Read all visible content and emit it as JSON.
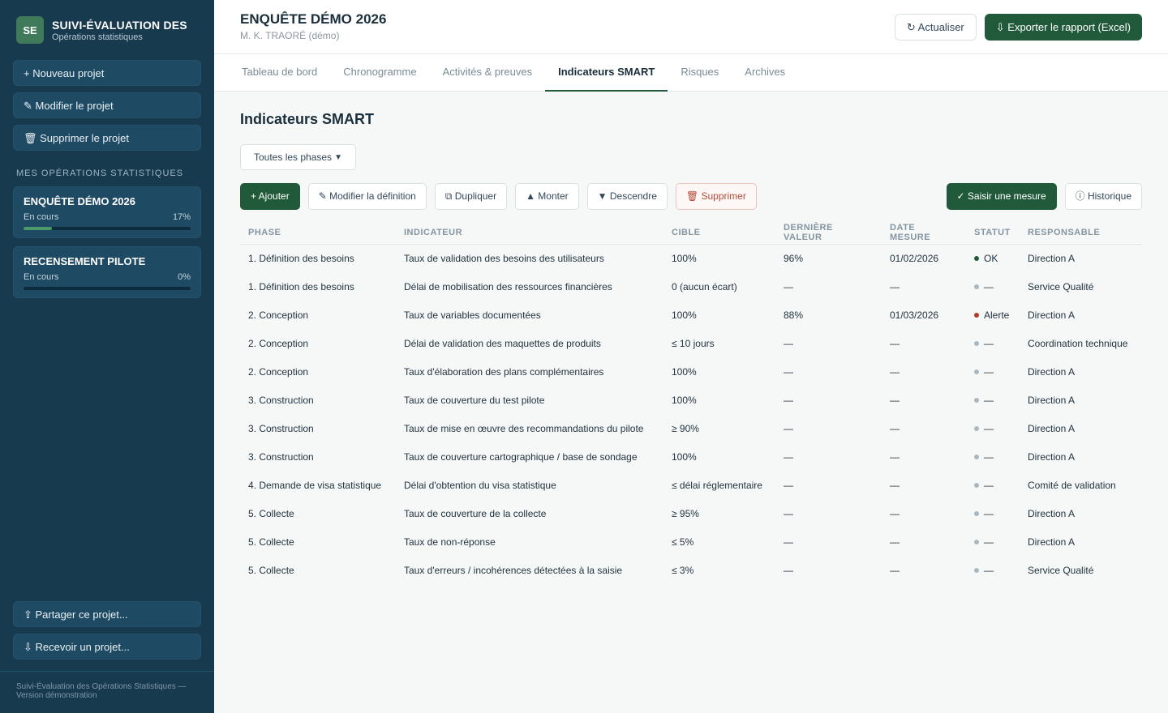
{
  "brand": {
    "logo": "SE",
    "title": "SUIVI-ÉVALUATION DES",
    "subtitle": "Opérations statistiques"
  },
  "sidebar": {
    "actions": [
      {
        "label": "+ Nouveau projet"
      },
      {
        "label": "✎ Modifier le projet"
      },
      {
        "label": "🗑 Supprimer le projet"
      }
    ],
    "section_label": "MES OPÉRATIONS STATISTIQUES",
    "projects": [
      {
        "name": "ENQUÊTE DÉMO 2026",
        "status": "En cours",
        "progress_label": "17%",
        "progress": 0.17
      },
      {
        "name": "RECENSEMENT PILOTE",
        "status": "En cours",
        "progress_label": "0%",
        "progress": 0
      }
    ],
    "bottom": [
      {
        "label": "⇪ Partager ce projet..."
      },
      {
        "label": "⇩ Recevoir un projet..."
      }
    ],
    "footer": "Suivi-Évaluation des Opérations Statistiques — Version démonstration"
  },
  "header": {
    "title": "ENQUÊTE DÉMO 2026",
    "subtitle": "M. K. TRAORÉ (démo)",
    "refresh": "↻ Actualiser",
    "export": "⇩ Exporter le rapport (Excel)"
  },
  "tabs": [
    {
      "label": "Tableau de bord",
      "active": false
    },
    {
      "label": "Chronogramme",
      "active": false
    },
    {
      "label": "Activités & preuves",
      "active": false
    },
    {
      "label": "Indicateurs SMART",
      "active": true
    },
    {
      "label": "Risques",
      "active": false
    },
    {
      "label": "Archives",
      "active": false
    }
  ],
  "main": {
    "title": "Indicateurs SMART",
    "phase_select": "Toutes les phases",
    "toolbar_left": [
      {
        "label": "+ Ajouter",
        "kind": "primary"
      },
      {
        "label": "✎ Modifier la définition",
        "kind": ""
      },
      {
        "label": "⧉ Dupliquer",
        "kind": ""
      },
      {
        "label": "▲ Monter",
        "kind": ""
      },
      {
        "label": "▼ Descendre",
        "kind": ""
      },
      {
        "label": "🗑 Supprimer",
        "kind": "danger"
      }
    ],
    "toolbar_right": [
      {
        "label": "✓ Saisir une mesure",
        "kind": "primary"
      },
      {
        "label": "ⓘ Historique",
        "kind": ""
      }
    ]
  },
  "colors": {
    "ok": "#1f5a36",
    "alerte": "#b33a2a",
    "none": "#a9b7bf"
  },
  "table": {
    "headers": [
      "PHASE",
      "INDICATEUR",
      "CIBLE",
      "DERNIÈRE VALEUR",
      "DATE MESURE",
      "STATUT",
      "RESPONSABLE"
    ],
    "rows": [
      [
        "1. Définition des besoins",
        "Taux de validation des besoins des utilisateurs",
        "100%",
        "96%",
        "01/02/2026",
        "OK",
        "Direction A"
      ],
      [
        "1. Définition des besoins",
        "Délai de mobilisation des ressources financières",
        "0 (aucun écart)",
        "—",
        "—",
        "—",
        "Service Qualité"
      ],
      [
        "2. Conception",
        "Taux de variables documentées",
        "100%",
        "88%",
        "01/03/2026",
        "Alerte",
        "Direction A"
      ],
      [
        "2. Conception",
        "Délai de validation des maquettes de produits",
        "≤ 10 jours",
        "—",
        "—",
        "—",
        "Coordination technique"
      ],
      [
        "2. Conception",
        "Taux d'élaboration des plans complémentaires",
        "100%",
        "—",
        "—",
        "—",
        "Direction A"
      ],
      [
        "3. Construction",
        "Taux de couverture du test pilote",
        "100%",
        "—",
        "—",
        "—",
        "Direction A"
      ],
      [
        "3. Construction",
        "Taux de mise en œuvre des recommandations du pilote",
        "≥ 90%",
        "—",
        "—",
        "—",
        "Direction A"
      ],
      [
        "3. Construction",
        "Taux de couverture cartographique / base de sondage",
        "100%",
        "—",
        "—",
        "—",
        "Direction A"
      ],
      [
        "4. Demande de visa statistique",
        "Délai d'obtention du visa statistique",
        "≤ délai réglementaire",
        "—",
        "—",
        "—",
        "Comité de validation"
      ],
      [
        "5. Collecte",
        "Taux de couverture de la collecte",
        "≥ 95%",
        "—",
        "—",
        "—",
        "Direction A"
      ],
      [
        "5. Collecte",
        "Taux de non-réponse",
        "≤ 5%",
        "—",
        "—",
        "—",
        "Direction A"
      ],
      [
        "5. Collecte",
        "Taux d'erreurs / incohérences détectées à la saisie",
        "≤ 3%",
        "—",
        "—",
        "—",
        "Service Qualité"
      ]
    ]
  }
}
